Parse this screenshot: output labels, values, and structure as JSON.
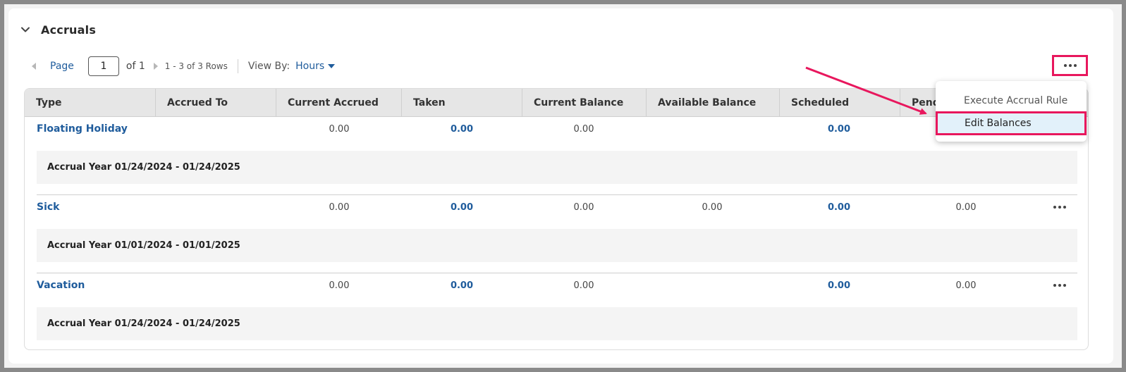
{
  "section": {
    "title": "Accruals"
  },
  "pager": {
    "page_label": "Page",
    "page_value": "1",
    "of_label": "of 1",
    "rows_label": "1 - 3 of 3 Rows",
    "viewby_label": "View By:",
    "viewby_value": "Hours"
  },
  "table": {
    "columns": [
      "Type",
      "Accrued To",
      "Current Accrued",
      "Taken",
      "Current Balance",
      "Available Balance",
      "Scheduled",
      "Pend"
    ],
    "rows": [
      {
        "type": "Floating Holiday",
        "current_accrued": "0.00",
        "taken": "0.00",
        "current_balance": "0.00",
        "available_balance": "",
        "scheduled": "0.00",
        "pending": "",
        "accrual_year": "Accrual Year 01/24/2024 - 01/24/2025"
      },
      {
        "type": "Sick",
        "current_accrued": "0.00",
        "taken": "0.00",
        "current_balance": "0.00",
        "available_balance": "0.00",
        "scheduled": "0.00",
        "pending": "0.00",
        "accrual_year": "Accrual Year 01/01/2024 - 01/01/2025"
      },
      {
        "type": "Vacation",
        "current_accrued": "0.00",
        "taken": "0.00",
        "current_balance": "0.00",
        "available_balance": "",
        "scheduled": "0.00",
        "pending": "0.00",
        "accrual_year": "Accrual Year 01/24/2024 - 01/24/2025"
      }
    ]
  },
  "menu": {
    "items": [
      "Execute Accrual Rule",
      "Edit Balances"
    ],
    "highlighted": "Edit Balances"
  },
  "colors": {
    "link": "#1f5c9c",
    "annotation": "#e8175d",
    "highlight_bg": "#e2f1fa"
  },
  "icons": {
    "collapse": "chevron-down-icon",
    "more": "more-horizontal-icon",
    "prev": "caret-left-icon",
    "next": "caret-right-icon",
    "dropdown": "caret-down-icon"
  }
}
